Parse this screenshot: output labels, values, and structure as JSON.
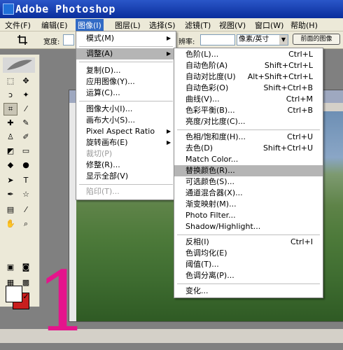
{
  "app": {
    "title": "Adobe Photoshop"
  },
  "menubar": [
    {
      "label": "文件(F)"
    },
    {
      "label": "编辑(E)"
    },
    {
      "label": "图像(I)"
    },
    {
      "label": "图层(L)"
    },
    {
      "label": "选择(S)"
    },
    {
      "label": "滤镜(T)"
    },
    {
      "label": "视图(V)"
    },
    {
      "label": "窗口(W)"
    },
    {
      "label": "帮助(H)"
    }
  ],
  "options": {
    "width_label": "宽度:",
    "resolution_label": "辨率:",
    "unit_value": "像素/英寸",
    "front_image_button": "前面的图像"
  },
  "image_menu": [
    {
      "label": "模式(M)",
      "submenu": true
    },
    {
      "label": "调整(A)",
      "submenu": true
    },
    {
      "label": "复制(D)..."
    },
    {
      "label": "应用图像(Y)..."
    },
    {
      "label": "运算(C)..."
    },
    {
      "label": "图像大小(I)..."
    },
    {
      "label": "画布大小(S)..."
    },
    {
      "label": "Pixel Aspect Ratio",
      "submenu": true
    },
    {
      "label": "旋转画布(E)",
      "submenu": true
    },
    {
      "label": "裁切(P)",
      "disabled": true
    },
    {
      "label": "修整(R)..."
    },
    {
      "label": "显示全部(V)"
    },
    {
      "label": "陷印(T)...",
      "disabled": true
    }
  ],
  "adjust_menu": [
    {
      "label": "色阶(L)...",
      "shortcut": "Ctrl+L"
    },
    {
      "label": "自动色阶(A)",
      "shortcut": "Shift+Ctrl+L"
    },
    {
      "label": "自动对比度(U)",
      "shortcut": "Alt+Shift+Ctrl+L"
    },
    {
      "label": "自动色彩(O)",
      "shortcut": "Shift+Ctrl+B"
    },
    {
      "label": "曲线(V)...",
      "shortcut": "Ctrl+M"
    },
    {
      "label": "色彩平衡(B)...",
      "shortcut": "Ctrl+B"
    },
    {
      "label": "亮度/对比度(C)..."
    },
    {
      "label": "色相/饱和度(H)...",
      "shortcut": "Ctrl+U"
    },
    {
      "label": "去色(D)",
      "shortcut": "Shift+Ctrl+U"
    },
    {
      "label": "Match Color..."
    },
    {
      "label": "替换颜色(R)..."
    },
    {
      "label": "可选颜色(S)..."
    },
    {
      "label": "通道混合器(X)..."
    },
    {
      "label": "渐变映射(M)..."
    },
    {
      "label": "Photo Filter..."
    },
    {
      "label": "Shadow/Highlight..."
    },
    {
      "label": "反相(I)",
      "shortcut": "Ctrl+I"
    },
    {
      "label": "色调均化(E)"
    },
    {
      "label": "阈值(T)..."
    },
    {
      "label": "色调分离(P)..."
    },
    {
      "label": "变化..."
    }
  ],
  "overlay_numeral": "1",
  "colors": {
    "accent": "#316ac5",
    "numeral": "#e5148c",
    "foreground_swatch": "#ffffff",
    "background_swatch": "#c81e1e"
  }
}
